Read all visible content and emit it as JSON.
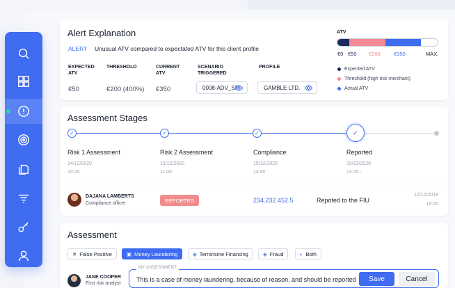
{
  "alert": {
    "title": "Alert Explanation",
    "tag": "ALERT",
    "message": "Unusual ATV compared to expectated ATV for this client profile",
    "headers": [
      "EXPECTED ATV",
      "THRESHOLD",
      "CURRENT ATV",
      "SCENARIO TRIGGERED",
      "PROFILE"
    ],
    "expected_atv": "€50",
    "threshold": "€200 (400%)",
    "current_atv": "€350",
    "scenario": "0008-ADV_SP",
    "profile": "GAMBLE LTD."
  },
  "atv": {
    "title": "ATV",
    "labels": [
      "€0",
      "€50",
      "€200",
      "€350",
      "MAX."
    ],
    "segments": [
      {
        "name": "Expected ATV",
        "from": 0,
        "to": 50,
        "color": "#1c2a5e"
      },
      {
        "name": "Threshold (high risk merchant)",
        "from": 50,
        "to": 200,
        "color": "#f48a93"
      },
      {
        "name": "Actual ATV",
        "from": 200,
        "to": 350,
        "color": "#3f6cf0"
      }
    ],
    "legend": [
      "Expected ATV",
      "Threshold (high risk merchant)",
      "Actual ATV"
    ],
    "legend_colors": [
      "#1c2a5e",
      "#f48a93",
      "#3f6cf0"
    ]
  },
  "stages": {
    "title": "Assessment Stages",
    "items": [
      {
        "name": "Risk 1 Assessment",
        "date": "14/12/2020",
        "time": "10:20"
      },
      {
        "name": "Risk 2 Assessment",
        "date": "15/12/2020",
        "time": "11:00"
      },
      {
        "name": "Compliance",
        "date": "15/12/2020",
        "time": "14:00"
      },
      {
        "name": "Reported",
        "date": "15/12/2020",
        "time": "14:20  -"
      }
    ],
    "row": {
      "name": "DAJANA LAMBERTS",
      "role": "Compliance officer",
      "status": "REPORTED",
      "number": "234.232.452.5",
      "note": "Repoted to the FIU",
      "date": "12/12/2019",
      "time": "14:20"
    }
  },
  "assessment": {
    "title": "Assessment",
    "filters": [
      "False Positive",
      "Money Laundering",
      "Terrorisme Financing",
      "Fraud",
      "Both"
    ],
    "user_name": "JANE COOPER",
    "user_role": "First risk analyst",
    "field_label": "MY ASSESSMENT",
    "field_value": "This is a case of money laundering, because of reason, and should be reported",
    "save": "Save",
    "cancel": "Cancel"
  }
}
